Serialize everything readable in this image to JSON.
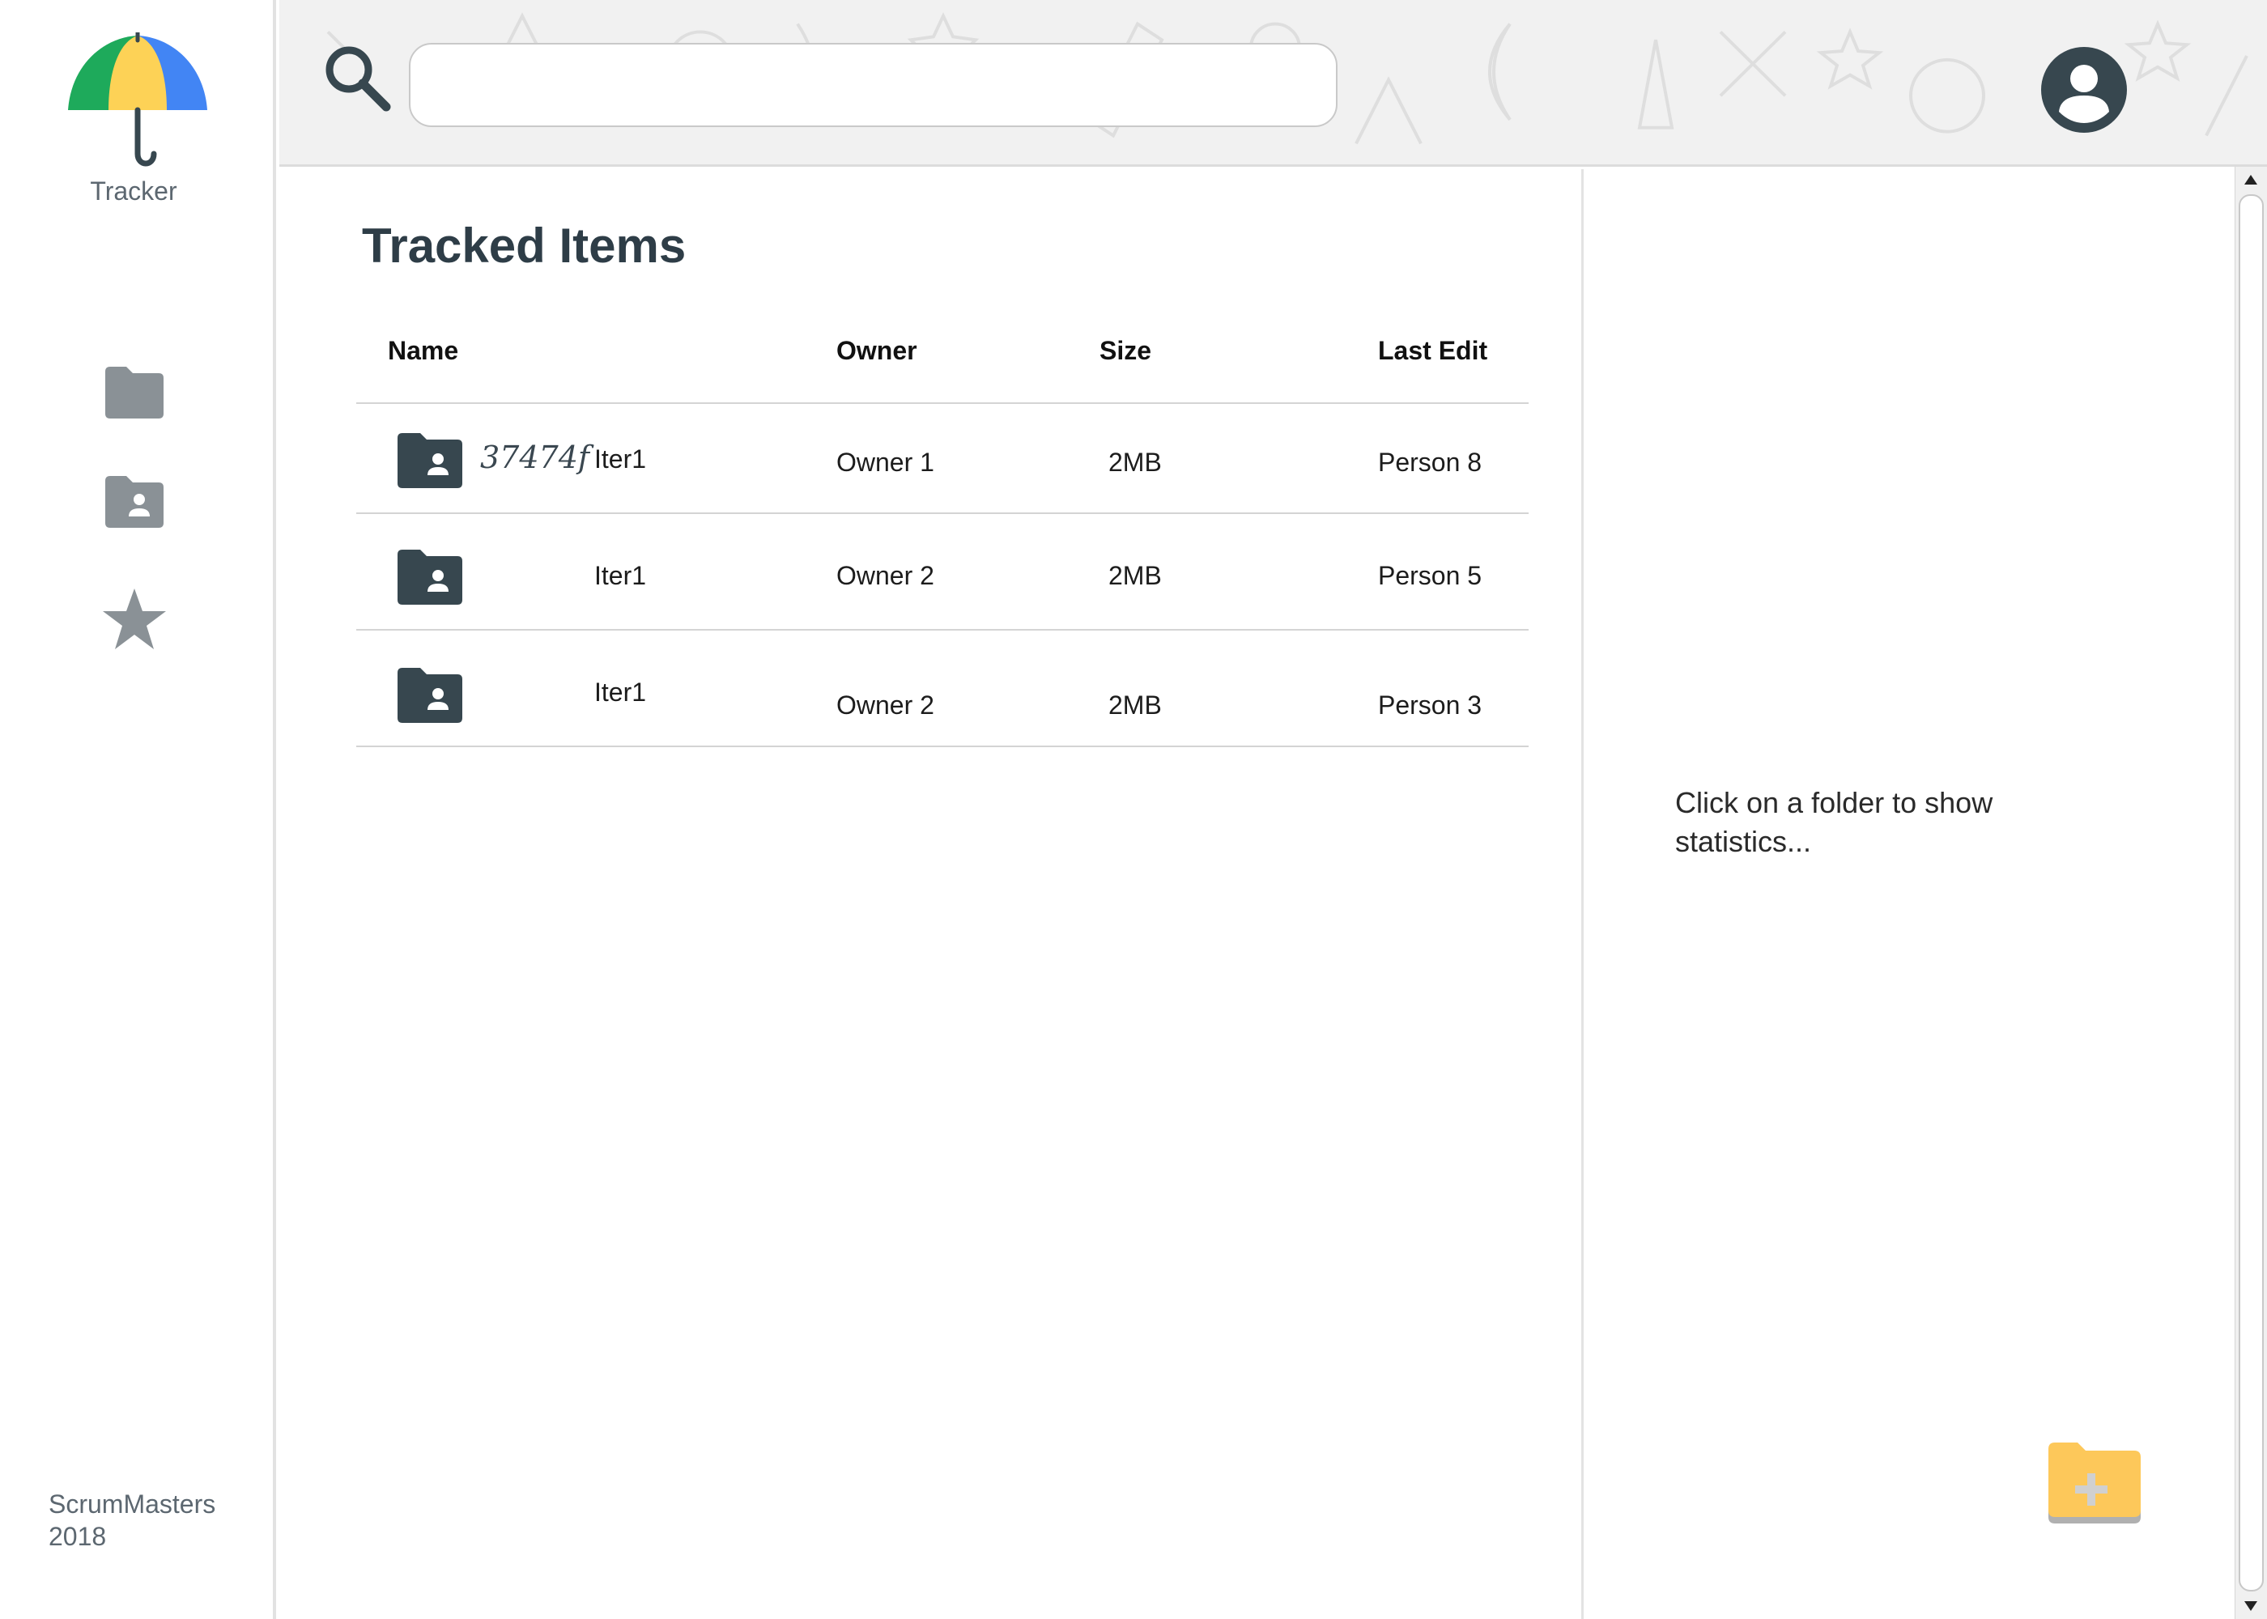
{
  "app": {
    "name": "Tracker",
    "footer_line1": "ScrumMasters",
    "footer_line2": "2018"
  },
  "sidebar": {
    "items": [
      {
        "name": "folder-icon"
      },
      {
        "name": "shared-folder-icon"
      },
      {
        "name": "star-icon"
      }
    ]
  },
  "search": {
    "value": "",
    "placeholder": ""
  },
  "main": {
    "title": "Tracked Items",
    "columns": [
      "Name",
      "Owner",
      "Size",
      "Last Edit"
    ],
    "rows": [
      {
        "tag": "37474f",
        "name": "Iter1",
        "owner": "Owner 1",
        "size": "2MB",
        "last_edit": "Person 8"
      },
      {
        "tag": "",
        "name": "Iter1",
        "owner": "Owner 2",
        "size": "2MB",
        "last_edit": "Person 5"
      },
      {
        "tag": "",
        "name": "Iter1",
        "owner": "Owner 2",
        "size": "2MB",
        "last_edit": "Person 3"
      }
    ]
  },
  "stats": {
    "hint": "Click on a folder to show statistics..."
  },
  "colors": {
    "primary_dark": "#37474f",
    "sidebar_icon": "#8a9196",
    "accent_yellow": "#fdc85a",
    "umbrella_green": "#1eaa5b",
    "umbrella_yellow": "#fdd256",
    "umbrella_blue": "#4285f4"
  }
}
